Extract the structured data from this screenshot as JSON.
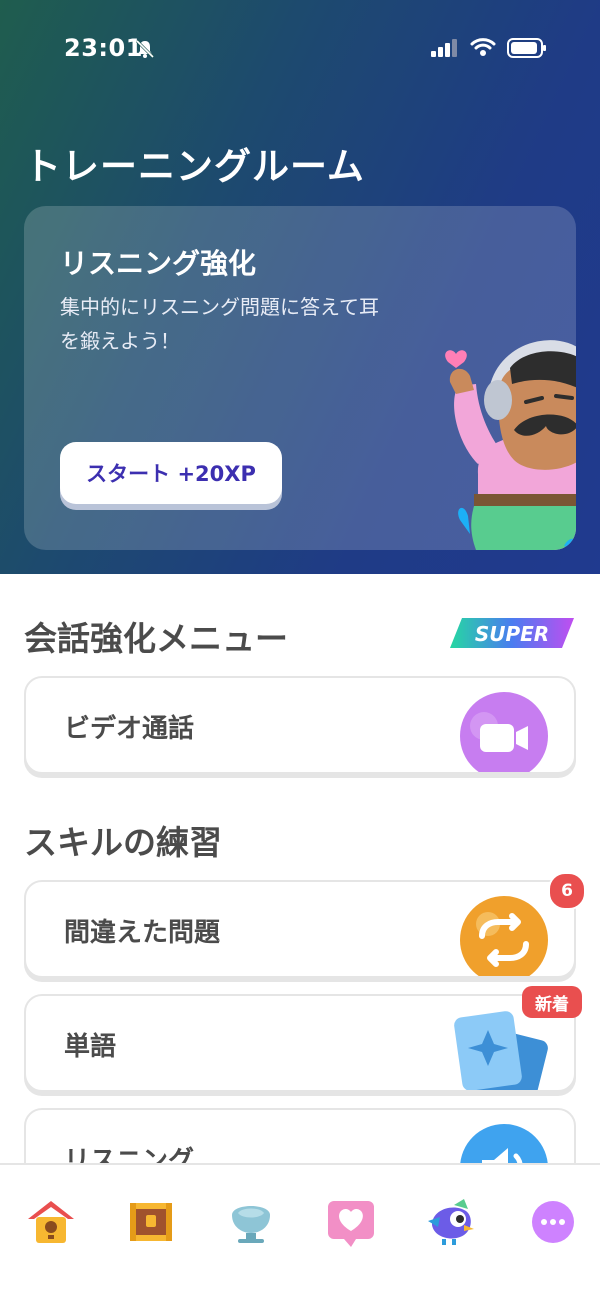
{
  "status_bar": {
    "time": "23:01"
  },
  "header": {
    "title": "トレーニングルーム"
  },
  "hero_card": {
    "title": "リスニング強化",
    "description": "集中的にリスニング問題に答えて耳を鍛えよう！",
    "start_button": "スタート +20XP"
  },
  "conversation": {
    "title": "会話強化メニュー",
    "super_badge": "SUPER",
    "items": [
      {
        "label": "ビデオ通話",
        "icon": "video-camera-icon"
      }
    ]
  },
  "skills": {
    "title": "スキルの練習",
    "items": [
      {
        "label": "間違えた問題",
        "icon": "repeat-arrows-icon",
        "badge": "6"
      },
      {
        "label": "単語",
        "icon": "cards-icon",
        "badge": "新着"
      },
      {
        "label": "リスニング",
        "icon": "speaker-icon"
      }
    ]
  },
  "bottom_nav": {
    "items": [
      {
        "icon": "home-birdhouse-icon"
      },
      {
        "icon": "treasure-chest-icon"
      },
      {
        "icon": "shell-icon"
      },
      {
        "icon": "heart-chat-icon"
      },
      {
        "icon": "bird-character-icon"
      },
      {
        "icon": "more-icon"
      }
    ]
  },
  "colors": {
    "accent": "#3c2fb0",
    "alert": "#e94f4f",
    "super_gradient": "#39d6a8"
  }
}
